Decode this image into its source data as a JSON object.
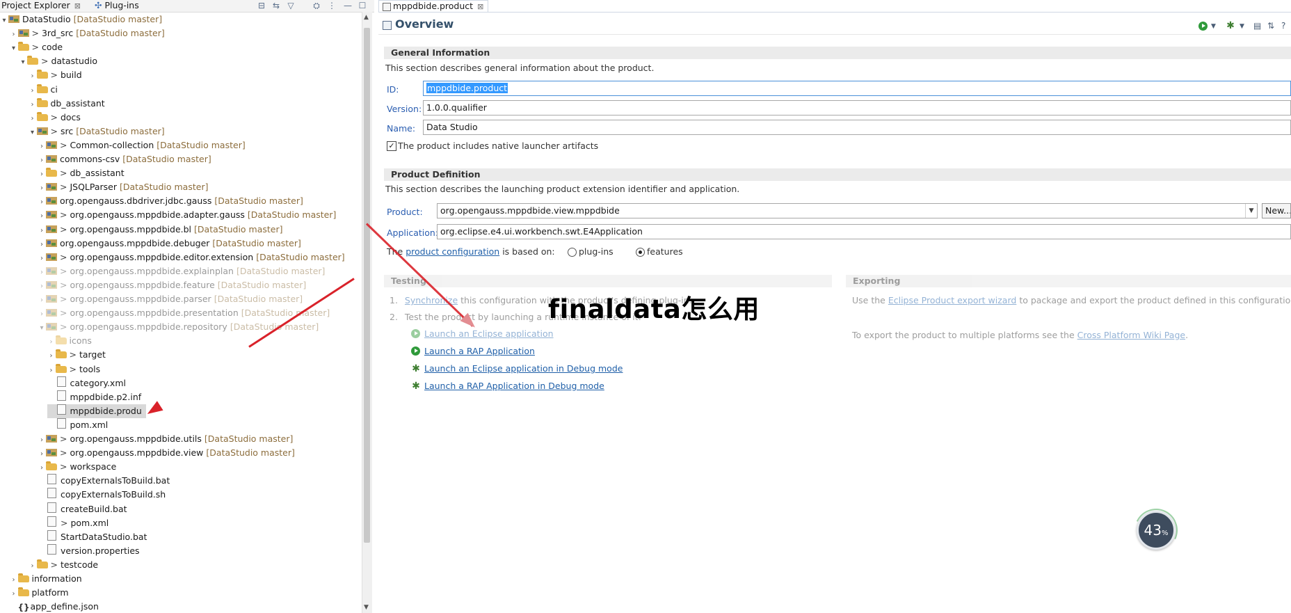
{
  "left_panel": {
    "tabs": [
      {
        "label": "Project Explorer",
        "close": "⊠"
      },
      {
        "label": "Plug-ins"
      }
    ],
    "tree": [
      {
        "depth": 0,
        "twisty": "v",
        "icon": "project",
        "prefix": "",
        "name": "DataStudio",
        "dec": "[DataStudio master]",
        "dim": false
      },
      {
        "depth": 1,
        "twisty": ">",
        "icon": "project",
        "prefix": "> ",
        "name": "3rd_src",
        "dec": "[DataStudio master]",
        "dim": false
      },
      {
        "depth": 1,
        "twisty": "v",
        "icon": "folder",
        "prefix": "> ",
        "name": "code",
        "dec": "",
        "dim": false
      },
      {
        "depth": 2,
        "twisty": "v",
        "icon": "folder",
        "prefix": "> ",
        "name": "datastudio",
        "dec": "",
        "dim": false
      },
      {
        "depth": 3,
        "twisty": ">",
        "icon": "folder",
        "prefix": "> ",
        "name": "build",
        "dec": "",
        "dim": false
      },
      {
        "depth": 3,
        "twisty": ">",
        "icon": "folder",
        "prefix": "",
        "name": "ci",
        "dec": "",
        "dim": false
      },
      {
        "depth": 3,
        "twisty": ">",
        "icon": "folder",
        "prefix": "",
        "name": "db_assistant",
        "dec": "",
        "dim": false
      },
      {
        "depth": 3,
        "twisty": ">",
        "icon": "folder",
        "prefix": "> ",
        "name": "docs",
        "dec": "",
        "dim": false
      },
      {
        "depth": 3,
        "twisty": "v",
        "icon": "project",
        "prefix": "> ",
        "name": "src",
        "dec": "[DataStudio master]",
        "dim": false
      },
      {
        "depth": 4,
        "twisty": ">",
        "icon": "project",
        "prefix": "> ",
        "name": "Common-collection",
        "dec": "[DataStudio master]",
        "dim": false
      },
      {
        "depth": 4,
        "twisty": ">",
        "icon": "project",
        "prefix": "",
        "name": "commons-csv",
        "dec": "[DataStudio master]",
        "dim": false
      },
      {
        "depth": 4,
        "twisty": ">",
        "icon": "folder",
        "prefix": "> ",
        "name": "db_assistant",
        "dec": "",
        "dim": false
      },
      {
        "depth": 4,
        "twisty": ">",
        "icon": "project",
        "prefix": "> ",
        "name": "JSQLParser",
        "dec": "[DataStudio master]",
        "dim": false
      },
      {
        "depth": 4,
        "twisty": ">",
        "icon": "project",
        "prefix": "",
        "name": "org.opengauss.dbdriver.jdbc.gauss",
        "dec": "[DataStudio master]",
        "dim": false
      },
      {
        "depth": 4,
        "twisty": ">",
        "icon": "project",
        "prefix": "> ",
        "name": "org.opengauss.mppdbide.adapter.gauss",
        "dec": "[DataStudio master]",
        "dim": false
      },
      {
        "depth": 4,
        "twisty": ">",
        "icon": "project",
        "prefix": "> ",
        "name": "org.opengauss.mppdbide.bl",
        "dec": "[DataStudio master]",
        "dim": false
      },
      {
        "depth": 4,
        "twisty": ">",
        "icon": "project",
        "prefix": "",
        "name": "org.opengauss.mppdbide.debuger",
        "dec": "[DataStudio master]",
        "dim": false
      },
      {
        "depth": 4,
        "twisty": ">",
        "icon": "project",
        "prefix": "> ",
        "name": "org.opengauss.mppdbide.editor.extension",
        "dec": "[DataStudio master]",
        "dim": false
      },
      {
        "depth": 4,
        "twisty": ">",
        "icon": "project",
        "prefix": "> ",
        "name": "org.opengauss.mppdbide.explainplan",
        "dec": "[DataStudio master]",
        "dim": true
      },
      {
        "depth": 4,
        "twisty": ">",
        "icon": "project",
        "prefix": "> ",
        "name": "org.opengauss.mppdbide.feature",
        "dec": "[DataStudio master]",
        "dim": true
      },
      {
        "depth": 4,
        "twisty": ">",
        "icon": "project",
        "prefix": "> ",
        "name": "org.opengauss.mppdbide.parser",
        "dec": "[DataStudio master]",
        "dim": true
      },
      {
        "depth": 4,
        "twisty": ">",
        "icon": "project",
        "prefix": "> ",
        "name": "org.opengauss.mppdbide.presentation",
        "dec": "[DataStudio master]",
        "dim": true
      },
      {
        "depth": 4,
        "twisty": "v",
        "icon": "project",
        "prefix": "> ",
        "name": "org.opengauss.mppdbide.repository",
        "dec": "[DataStudio master]",
        "dim": true
      },
      {
        "depth": 5,
        "twisty": ">",
        "icon": "folder",
        "prefix": "",
        "name": "icons",
        "dec": "",
        "dim": true
      },
      {
        "depth": 5,
        "twisty": ">",
        "icon": "folder",
        "prefix": "> ",
        "name": "target",
        "dec": "",
        "dim": false
      },
      {
        "depth": 5,
        "twisty": ">",
        "icon": "folder",
        "prefix": "> ",
        "name": "tools",
        "dec": "",
        "dim": false
      },
      {
        "depth": 5,
        "twisty": "",
        "icon": "file",
        "prefix": "",
        "name": "category.xml",
        "dec": "",
        "dim": false
      },
      {
        "depth": 5,
        "twisty": "",
        "icon": "file",
        "prefix": "",
        "name": "mppdbide.p2.inf",
        "dec": "",
        "dim": false
      },
      {
        "depth": 5,
        "twisty": "",
        "icon": "file",
        "prefix": "",
        "name": "mppdbide.produ",
        "dec": "",
        "dim": false,
        "selected": true
      },
      {
        "depth": 5,
        "twisty": "",
        "icon": "file",
        "prefix": "",
        "name": "pom.xml",
        "dec": "",
        "dim": false
      },
      {
        "depth": 4,
        "twisty": ">",
        "icon": "project",
        "prefix": "> ",
        "name": "org.opengauss.mppdbide.utils",
        "dec": "[DataStudio master]",
        "dim": false
      },
      {
        "depth": 4,
        "twisty": ">",
        "icon": "project",
        "prefix": "> ",
        "name": "org.opengauss.mppdbide.view",
        "dec": "[DataStudio master]",
        "dim": false
      },
      {
        "depth": 4,
        "twisty": ">",
        "icon": "folder",
        "prefix": "> ",
        "name": "workspace",
        "dec": "",
        "dim": false
      },
      {
        "depth": 4,
        "twisty": "",
        "icon": "file",
        "prefix": "",
        "name": "copyExternalsToBuild.bat",
        "dec": "",
        "dim": false
      },
      {
        "depth": 4,
        "twisty": "",
        "icon": "file",
        "prefix": "",
        "name": "copyExternalsToBuild.sh",
        "dec": "",
        "dim": false
      },
      {
        "depth": 4,
        "twisty": "",
        "icon": "file",
        "prefix": "",
        "name": "createBuild.bat",
        "dec": "",
        "dim": false
      },
      {
        "depth": 4,
        "twisty": "",
        "icon": "file",
        "prefix": "> ",
        "name": "pom.xml",
        "dec": "",
        "dim": false
      },
      {
        "depth": 4,
        "twisty": "",
        "icon": "file",
        "prefix": "",
        "name": "StartDataStudio.bat",
        "dec": "",
        "dim": false
      },
      {
        "depth": 4,
        "twisty": "",
        "icon": "file",
        "prefix": "",
        "name": "version.properties",
        "dec": "",
        "dim": false
      },
      {
        "depth": 3,
        "twisty": ">",
        "icon": "folder",
        "prefix": "> ",
        "name": "testcode",
        "dec": "",
        "dim": false
      },
      {
        "depth": 1,
        "twisty": ">",
        "icon": "folder",
        "prefix": "",
        "name": "information",
        "dec": "",
        "dim": false
      },
      {
        "depth": 1,
        "twisty": ">",
        "icon": "folder",
        "prefix": "",
        "name": "platform",
        "dec": "",
        "dim": false
      },
      {
        "depth": 1,
        "twisty": "",
        "icon": "json",
        "prefix": "",
        "name": "app_define.json",
        "dec": "",
        "dim": false
      }
    ]
  },
  "editor": {
    "tab_label": "mppdbide.product",
    "tab_close": "⊠",
    "title": "Overview",
    "general": {
      "header": "General Information",
      "desc": "This section describes general information about the product.",
      "id_label": "ID:",
      "id_value": "mppdbide.product",
      "version_label": "Version:",
      "version_value": "1.0.0.qualifier",
      "name_label": "Name:",
      "name_value": "Data Studio",
      "native_launcher_label": "The product includes native launcher artifacts",
      "native_launcher_checked": true
    },
    "definition": {
      "header": "Product Definition",
      "desc": "This section describes the launching product extension identifier and application.",
      "product_label": "Product:",
      "product_value": "org.opengauss.mppdbide.view.mppdbide",
      "new_button": "New...",
      "application_label": "Application:",
      "application_value": "org.eclipse.e4.ui.workbench.swt.E4Application",
      "based_prefix": "The",
      "based_link": "product configuration",
      "based_suffix": "is based on:",
      "option_plugins": "plug-ins",
      "option_features": "features",
      "selected_option": "features"
    },
    "testing": {
      "header": "Testing",
      "step1_num": "1.",
      "step1_link": "Synchronize",
      "step1_text": "this configuration with the product's defining plug-in.",
      "step2_num": "2.",
      "step2_text": "Test the product by launching a runtime instance of it:",
      "launch_links": [
        "Launch an Eclipse application",
        "Launch a RAP Application",
        "Launch an Eclipse application in Debug mode",
        "Launch a RAP Application in Debug mode"
      ]
    },
    "exporting": {
      "header": "Exporting",
      "text1_prefix": "Use the",
      "text1_link": "Eclipse Product export wizard",
      "text1_suffix": "to package and export the product defined in this configuration.",
      "text2_prefix": "To export the product to multiple platforms see the",
      "text2_link": "Cross Platform Wiki Page",
      "text2_suffix": "."
    }
  },
  "overlay": {
    "watermark": "finaldata怎么用",
    "progress_value": "43",
    "progress_unit": "%",
    "accent_arrow_color": "#d9222a"
  }
}
